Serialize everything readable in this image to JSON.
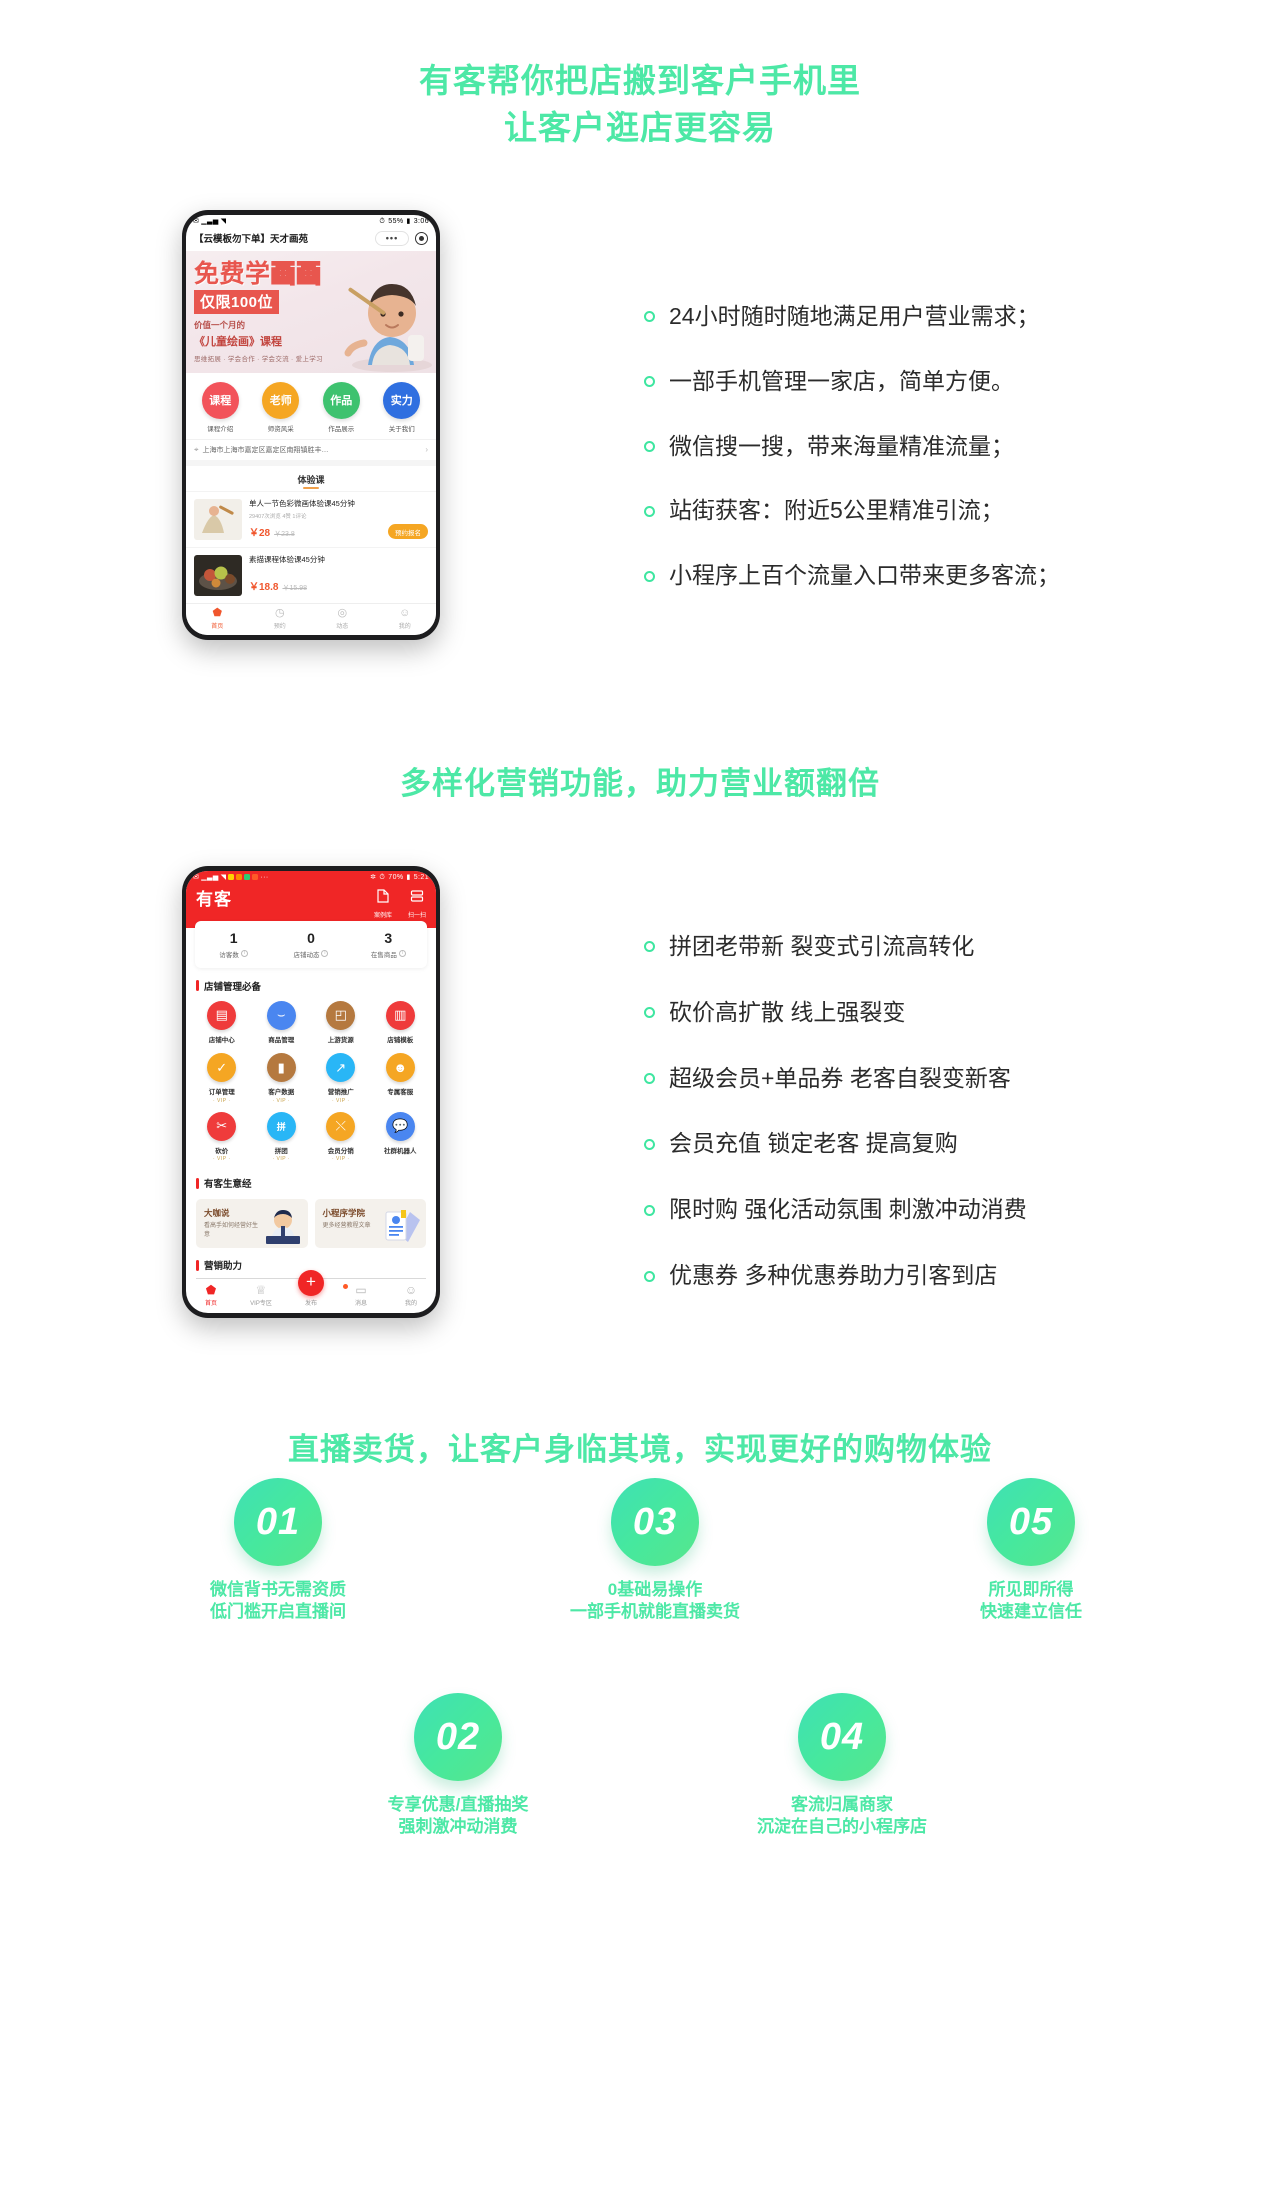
{
  "sections": [
    {
      "heading_line1": "有客帮你把店搬到客户手机里",
      "heading_line2": "让客户逛店更容易",
      "bullets": [
        "24小时随时随地满足用户营业需求；",
        "一部手机管理一家店，简单方便。",
        "微信搜一搜，带来海量精准流量；",
        "站街获客：附近5公里精准引流；",
        "小程序上百个流量入口带来更多客流；"
      ]
    },
    {
      "heading_line1": "多样化营销功能，助力营业额翻倍",
      "bullets": [
        "拼团老带新 裂变式引流高转化",
        "砍价高扩散 线上强裂变",
        "超级会员+单品券 老客自裂变新客",
        "会员充值 锁定老客 提高复购",
        "限时购 强化活动氛围 刺激冲动消费",
        "优惠券 多种优惠券助力引客到店"
      ]
    },
    {
      "heading_line1": "直播卖货，让客户身临其境，实现更好的购物体验"
    }
  ],
  "phone1": {
    "statusbar": {
      "left_icons": [
        "mail-icon",
        "signal-icon",
        "wifi-icon"
      ],
      "battery": "55%",
      "time": "3:06"
    },
    "title": "【云模板勿下单】天才画苑",
    "capsule": {
      "more_label": "•••",
      "target_label": "target-icon"
    },
    "hero": {
      "line1_a": "免费学",
      "line1_b": "画画",
      "line2": "仅限100位",
      "line3": "价值一个月的",
      "line4": "《儿童绘画》课程",
      "line5": "思维拓展 · 学会合作 · 学会交流 · 爱上学习"
    },
    "categories": [
      {
        "label_icon": "课程",
        "caption": "课程介绍",
        "color": "#f2535a"
      },
      {
        "label_icon": "老师",
        "caption": "师资风采",
        "color": "#f5a623"
      },
      {
        "label_icon": "作品",
        "caption": "作品展示",
        "color": "#3ec26f"
      },
      {
        "label_icon": "实力",
        "caption": "关于我们",
        "color": "#2f6fe0"
      }
    ],
    "address": "上海市上海市嘉定区嘉定区南翔镇胜丰…",
    "section_tab": "体验课",
    "products": [
      {
        "name": "单人一节色彩微画体验课45分钟",
        "sub": "29407次浏览  4赞  1评论",
        "price_now": "￥28",
        "price_old": "￥23.8",
        "button": "预约报名"
      },
      {
        "name": "素描课程体验课45分钟",
        "sub": "",
        "price_now": "￥18.8",
        "price_old": "￥15.98",
        "button": ""
      }
    ],
    "tabbar": [
      {
        "icon": "home-icon",
        "label": "首页",
        "active": true
      },
      {
        "icon": "calendar-icon",
        "label": "预约",
        "active": false
      },
      {
        "icon": "dynamic-icon",
        "label": "动态",
        "active": false
      },
      {
        "icon": "user-icon",
        "label": "我的",
        "active": false
      }
    ]
  },
  "phone2": {
    "statusbar": {
      "battery": "70%",
      "time": "5:21"
    },
    "logo": "有客",
    "header_actions": [
      {
        "icon": "case-library-icon",
        "label": "案例库"
      },
      {
        "icon": "scan-icon",
        "label": "扫一扫"
      }
    ],
    "stats": [
      {
        "num": "1",
        "label": "访客数"
      },
      {
        "num": "0",
        "label": "店铺动态"
      },
      {
        "num": "3",
        "label": "在售商品"
      }
    ],
    "group1_title": "店铺管理必备",
    "icons": [
      {
        "label": "店铺中心",
        "vip": "",
        "color": "#ef3b3b",
        "glyph": "shop-icon"
      },
      {
        "label": "商品管理",
        "vip": "",
        "color": "#4a86f0",
        "glyph": "bag-icon"
      },
      {
        "label": "上游货源",
        "vip": "",
        "color": "#b5793f",
        "glyph": "box-icon"
      },
      {
        "label": "店铺模板",
        "vip": "",
        "color": "#ef3b3b",
        "glyph": "template-icon"
      },
      {
        "label": "订单管理",
        "vip": "· VIP ·",
        "color": "#f5a623",
        "glyph": "clipboard-icon"
      },
      {
        "label": "客户数据",
        "vip": "· VIP ·",
        "color": "#b5793f",
        "glyph": "chart-icon"
      },
      {
        "label": "营销推广",
        "vip": "· VIP ·",
        "color": "#29b6f6",
        "glyph": "trend-icon"
      },
      {
        "label": "专属客服",
        "vip": "",
        "color": "#f5a623",
        "glyph": "headset-icon"
      },
      {
        "label": "砍价",
        "vip": "· VIP ·",
        "color": "#ef3b3b",
        "glyph": "axe-icon"
      },
      {
        "label": "拼团",
        "vip": "· VIP ·",
        "color": "#29b6f6",
        "glyph": "group-icon"
      },
      {
        "label": "会员分销",
        "vip": "· VIP ·",
        "color": "#f5a623",
        "glyph": "share-icon"
      },
      {
        "label": "社群机器人",
        "vip": "",
        "color": "#4a86f0",
        "glyph": "robot-icon"
      }
    ],
    "group2_title": "有客生意经",
    "cards": [
      {
        "title": "大咖说",
        "subtitle": "看高手如何经营好生意",
        "art": "speaker-illustration"
      },
      {
        "title": "小程序学院",
        "subtitle": "更多经营教程文章",
        "art": "document-illustration"
      }
    ],
    "group3_title": "营销助力",
    "tabbar": [
      {
        "icon": "home-icon",
        "label": "首页",
        "active": true
      },
      {
        "icon": "vip-icon",
        "label": "VIP专区",
        "active": false
      },
      {
        "icon": "plus-icon",
        "label": "发布",
        "active": false
      },
      {
        "icon": "message-icon",
        "label": "消息",
        "active": false,
        "badge": true
      },
      {
        "icon": "user-icon",
        "label": "我的",
        "active": false
      }
    ]
  },
  "live_features": [
    {
      "num": "01",
      "cap_line1": "微信背书无需资质",
      "cap_line2": "低门槛开启直播间"
    },
    {
      "num": "02",
      "cap_line1": "专享优惠/直播抽奖",
      "cap_line2": "强刺激冲动消费"
    },
    {
      "num": "03",
      "cap_line1": "0基础易操作",
      "cap_line2": "一部手机就能直播卖货"
    },
    {
      "num": "04",
      "cap_line1": "客流归属商家",
      "cap_line2": "沉淀在自己的小程序店"
    },
    {
      "num": "05",
      "cap_line1": "所见即所得",
      "cap_line2": "快速建立信任"
    }
  ],
  "colors": {
    "accent_green": "#4de8a6",
    "brand_red": "#f02626",
    "price_orange": "#f0562d"
  }
}
